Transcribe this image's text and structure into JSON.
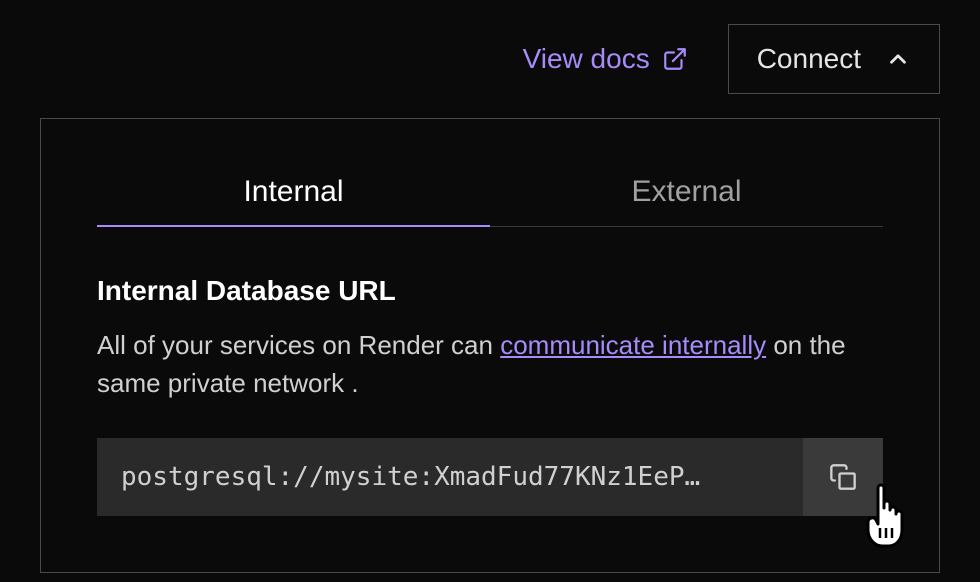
{
  "header": {
    "view_docs_label": "View docs",
    "connect_label": "Connect"
  },
  "tabs": {
    "internal": "Internal",
    "external": "External"
  },
  "content": {
    "title": "Internal Database URL",
    "desc_prefix": "All of your services on Render can ",
    "desc_link": "communicate internally",
    "desc_suffix": " on the same private network .",
    "url_value": "postgresql://mysite:XmadFud77KNz1EeP…"
  },
  "colors": {
    "accent": "#a78bfa",
    "bg": "#0a0a0a",
    "border": "#4a4a4a"
  }
}
